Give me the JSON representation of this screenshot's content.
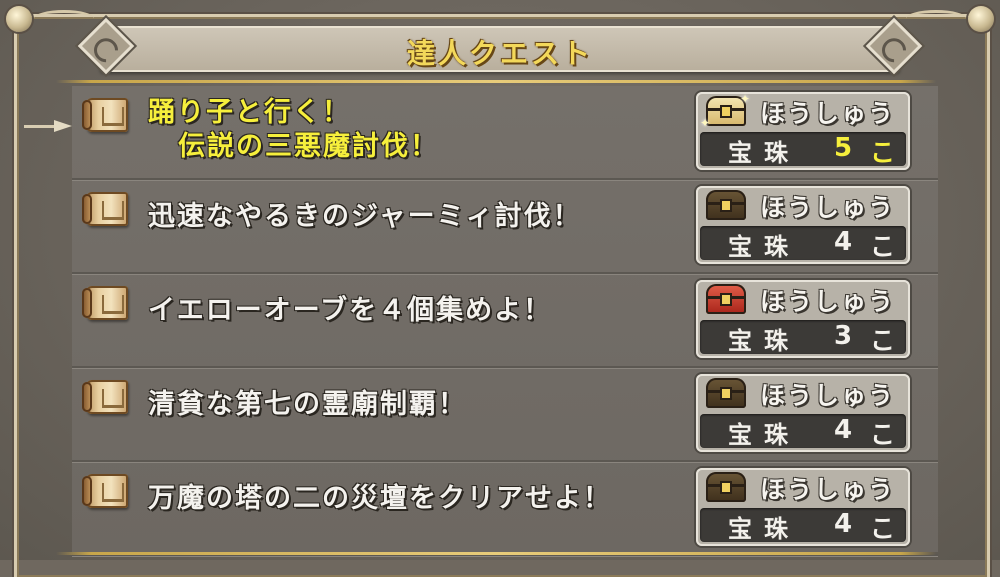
{
  "window": {
    "title": "達人クエスト"
  },
  "reward_header_label": "ほうしゅう",
  "quests": [
    {
      "title_line1": "踊り子と行く！",
      "title_line2": "伝説の三悪魔討伐！",
      "reward_item": "宝珠",
      "reward_count": "5",
      "reward_unit": "こ",
      "chest": "gold-chest-icon",
      "selected": true
    },
    {
      "title_line1": "迅速なやるきのジャーミィ討伐！",
      "title_line2": "",
      "reward_item": "宝珠",
      "reward_count": "4",
      "reward_unit": "こ",
      "chest": "dark-chest-icon",
      "selected": false
    },
    {
      "title_line1": "イエローオーブを４個集めよ！",
      "title_line2": "",
      "reward_item": "宝珠",
      "reward_count": "3",
      "reward_unit": "こ",
      "chest": "red-chest-icon",
      "selected": false
    },
    {
      "title_line1": "清貧な第七の霊廟制覇！",
      "title_line2": "",
      "reward_item": "宝珠",
      "reward_count": "4",
      "reward_unit": "こ",
      "chest": "dark-chest-icon",
      "selected": false
    },
    {
      "title_line1": "万魔の塔の二の災壇をクリアせよ！",
      "title_line2": "",
      "reward_item": "宝珠",
      "reward_count": "4",
      "reward_unit": "こ",
      "chest": "dark-chest-icon",
      "selected": false
    }
  ],
  "colors": {
    "selected_text": "#f6ef3c",
    "normal_text": "#f4f2ee",
    "title_text": "#f3d85a"
  }
}
